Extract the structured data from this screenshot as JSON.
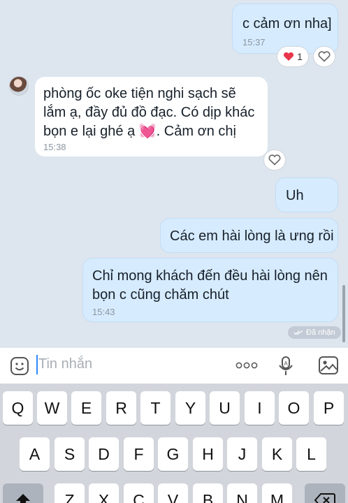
{
  "messages": [
    {
      "text": "c cảm ơn nha]",
      "time": "15:37"
    },
    {
      "text": "phòng ốc oke tiện nghi sạch sẽ lắm ạ, đầy đủ đồ đạc. Có dịp khác bọn e lại ghé ạ 💓. Cảm ơn chị",
      "time": "15:38"
    },
    {
      "text": "Uh"
    },
    {
      "text": "Các em hài lòng là ưng rồi"
    },
    {
      "text": "Chỉ mong khách đến đều hài lòng nên bọn c cũng chăm chút",
      "time": "15:43"
    }
  ],
  "reaction": {
    "count": "1"
  },
  "seen_label": "Đã nhận",
  "composer": {
    "placeholder": "Tin nhắn"
  },
  "keyboard": {
    "row1": [
      "Q",
      "W",
      "E",
      "R",
      "T",
      "Y",
      "U",
      "I",
      "O",
      "P"
    ],
    "row2": [
      "A",
      "S",
      "D",
      "F",
      "G",
      "H",
      "J",
      "K",
      "L"
    ],
    "row3": [
      "Z",
      "X",
      "C",
      "V",
      "B",
      "N",
      "M"
    ]
  },
  "colors": {
    "accent": "#2f88ff",
    "out_bubble": "#d6ebfd",
    "chat_bg": "#dde5ee"
  },
  "icons": [
    "heart-icon",
    "heart-outline-icon",
    "emoji-icon",
    "more-icon",
    "voice-icon",
    "image-icon",
    "shift-icon",
    "backspace-icon",
    "double-check-icon"
  ]
}
